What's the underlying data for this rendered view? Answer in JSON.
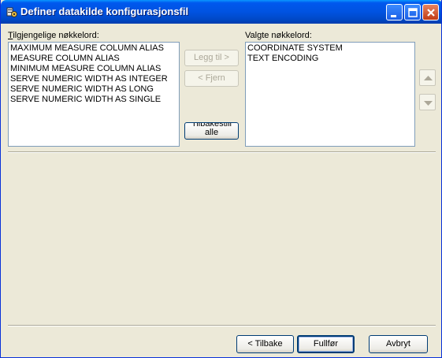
{
  "window": {
    "title": "Definer datakilde konfigurasjonsfil",
    "icon": "datasource-config-icon"
  },
  "available": {
    "label": "Tilgjengelige nøkkelord:",
    "items": [
      "MAXIMUM MEASURE COLUMN ALIAS",
      "MEASURE COLUMN ALIAS",
      "MINIMUM MEASURE COLUMN ALIAS",
      "SERVE NUMERIC WIDTH AS INTEGER",
      "SERVE NUMERIC WIDTH AS LONG",
      "SERVE NUMERIC WIDTH AS SINGLE"
    ]
  },
  "selected": {
    "label": "Valgte nøkkelord:",
    "items": [
      "COORDINATE SYSTEM",
      "TEXT ENCODING"
    ]
  },
  "middle": {
    "add_label": "Legg til >",
    "remove_label": "< Fjern",
    "reset_line1": "Tilbakestill",
    "reset_line2": "alle"
  },
  "footer": {
    "back_label": "< Tilbake",
    "finish_label": "Fullfør",
    "cancel_label": "Avbryt"
  }
}
